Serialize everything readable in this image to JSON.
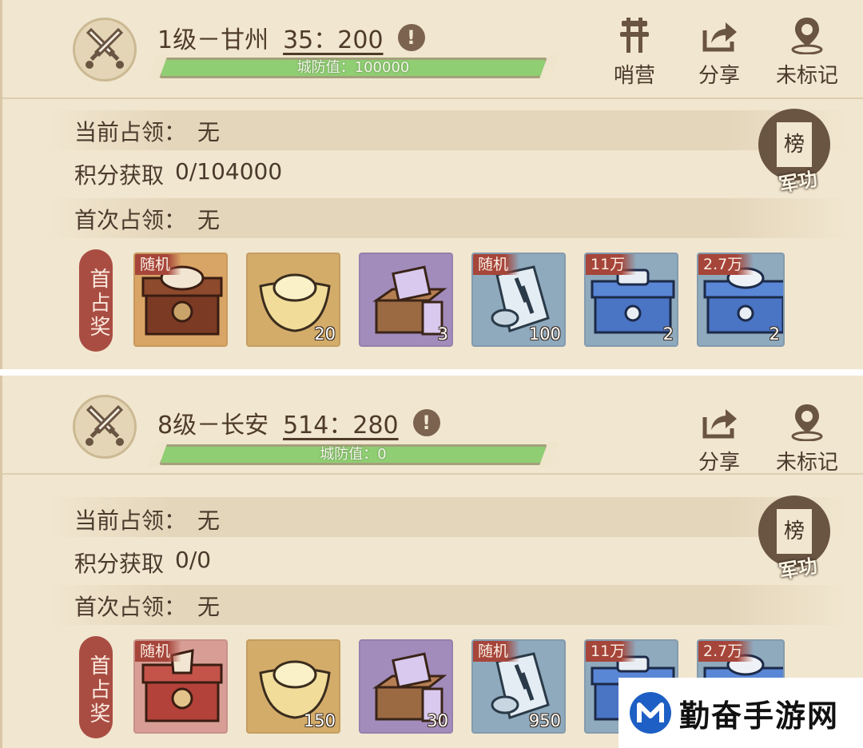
{
  "cities": [
    {
      "title": "1级－甘州",
      "coords": "35：200",
      "defense_label": "城防值：100000",
      "defense_fraction": 1.0,
      "buttons": [
        {
          "label": "哨营",
          "icon": "camp-icon"
        },
        {
          "label": "分享",
          "icon": "share-icon"
        },
        {
          "label": "未标记",
          "icon": "map-pin-icon"
        }
      ],
      "rank_badge": {
        "top": "榜",
        "bottom": "军功"
      },
      "rows": [
        {
          "label": "当前占领：",
          "value": "无"
        },
        {
          "label": "积分获取",
          "value": "0/104000"
        },
        {
          "label": "首次占领：",
          "value": "无"
        }
      ],
      "reward_label": "首占奖",
      "rewards": [
        {
          "corner": "随机",
          "count": "",
          "icon": "treasure-chest-icon",
          "bg": "bg-brown"
        },
        {
          "corner": "",
          "count": "20",
          "icon": "gold-ingot-icon",
          "bg": "bg-gold"
        },
        {
          "corner": "",
          "count": "3",
          "icon": "book-box-icon",
          "bg": "bg-purple"
        },
        {
          "corner": "随机",
          "count": "100",
          "icon": "scroll-icon",
          "bg": "bg-blue"
        },
        {
          "corner": "11万",
          "count": "2",
          "icon": "silver-chest-icon",
          "bg": "bg-blue"
        },
        {
          "corner": "2.7万",
          "count": "2",
          "icon": "blue-chest-icon",
          "bg": "bg-blue"
        }
      ]
    },
    {
      "title": "8级－长安",
      "coords": "514：280",
      "defense_label": "城防值：0",
      "defense_fraction": 1.0,
      "buttons": [
        {
          "label": "分享",
          "icon": "share-icon"
        },
        {
          "label": "未标记",
          "icon": "map-pin-icon"
        }
      ],
      "rank_badge": {
        "top": "榜",
        "bottom": "军功"
      },
      "rows": [
        {
          "label": "当前占领：",
          "value": "无"
        },
        {
          "label": "积分获取",
          "value": "0/0"
        },
        {
          "label": "首次占领：",
          "value": "无"
        }
      ],
      "reward_label": "首占奖",
      "rewards": [
        {
          "corner": "随机",
          "count": "",
          "icon": "red-chest-icon",
          "bg": "bg-red"
        },
        {
          "corner": "",
          "count": "150",
          "icon": "gold-ingot-icon",
          "bg": "bg-gold"
        },
        {
          "corner": "",
          "count": "30",
          "icon": "book-box-icon",
          "bg": "bg-purple"
        },
        {
          "corner": "随机",
          "count": "950",
          "icon": "scroll-icon",
          "bg": "bg-blue"
        },
        {
          "corner": "11万",
          "count": "",
          "icon": "silver-chest-icon",
          "bg": "bg-blue"
        },
        {
          "corner": "2.7万",
          "count": "",
          "icon": "blue-chest-icon",
          "bg": "bg-blue"
        }
      ]
    }
  ],
  "watermark": {
    "text": "勤奋手游网"
  }
}
